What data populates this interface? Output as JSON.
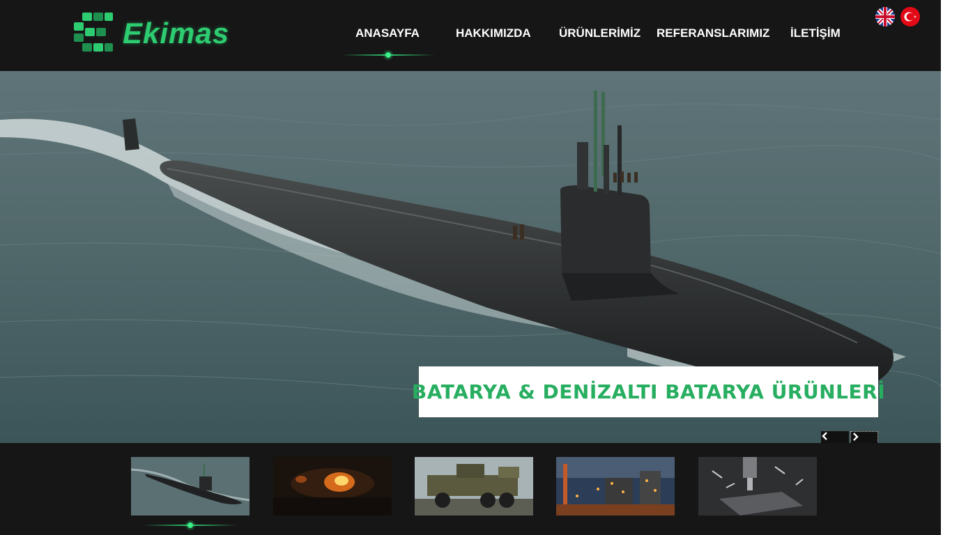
{
  "brand": {
    "name": "Ekimas",
    "accent": "#2ecc71",
    "dark_bg": "#161616"
  },
  "nav": {
    "items": [
      {
        "label": "ANASAYFA",
        "active": true
      },
      {
        "label": "HAKKIMIZDA",
        "active": false
      },
      {
        "label": "ÜRÜNLERİMİZ",
        "active": false
      },
      {
        "label": "REFERANSLARIMIZ",
        "active": false
      },
      {
        "label": "İLETİŞİM",
        "active": false
      }
    ]
  },
  "languages": [
    {
      "icon": "uk-flag-icon",
      "code": "en"
    },
    {
      "icon": "turkey-flag-icon",
      "code": "tr"
    }
  ],
  "hero": {
    "caption": "BATARYA & DENİZALTI BATARYA ÜRÜNLERİ",
    "prev_icon": "chevron-left-icon",
    "next_icon": "chevron-right-icon",
    "caption_color": "#27ae60"
  },
  "thumbnails": [
    {
      "subject": "submarine",
      "active": true
    },
    {
      "subject": "fire-explosion",
      "active": false
    },
    {
      "subject": "military-truck",
      "active": false
    },
    {
      "subject": "industrial-plant-night",
      "active": false
    },
    {
      "subject": "cnc-machining",
      "active": false
    }
  ]
}
